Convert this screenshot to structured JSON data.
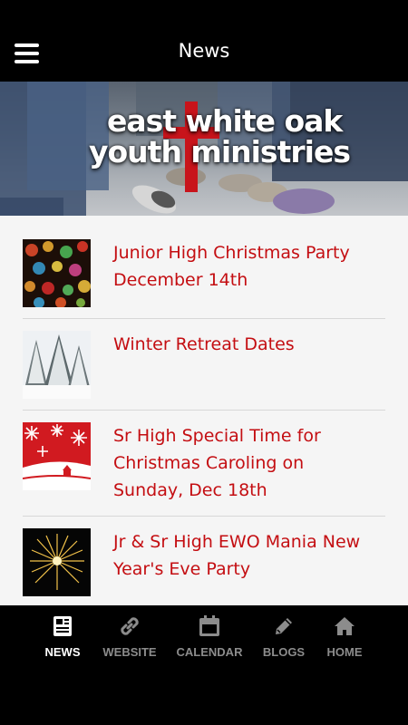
{
  "header": {
    "title": "News",
    "menu_icon": "hamburger-menu-icon"
  },
  "banner": {
    "line1": "east white oak",
    "line2": "youth ministries",
    "accent_color": "#c8141b"
  },
  "news": [
    {
      "title": "Junior High Christmas Party December 14th",
      "thumb": "bokeh-lights"
    },
    {
      "title": "Winter Retreat Dates",
      "thumb": "snowy-trees"
    },
    {
      "title": "Sr High Special Time for Christmas Caroling on Sunday, Dec 18th",
      "thumb": "red-snowflakes"
    },
    {
      "title": "Jr & Sr High EWO Mania New Year's Eve Party",
      "thumb": "fireworks"
    }
  ],
  "tabs": [
    {
      "label": "NEWS",
      "icon": "newspaper-icon",
      "active": true
    },
    {
      "label": "WEBSITE",
      "icon": "link-icon",
      "active": false
    },
    {
      "label": "CALENDAR",
      "icon": "calendar-icon",
      "active": false
    },
    {
      "label": "BLOGS",
      "icon": "pencil-icon",
      "active": false
    },
    {
      "label": "HOME",
      "icon": "home-icon",
      "active": false
    }
  ],
  "colors": {
    "title_red": "#c40e12",
    "tab_active": "#ffffff",
    "tab_inactive": "#8c8c8c"
  }
}
